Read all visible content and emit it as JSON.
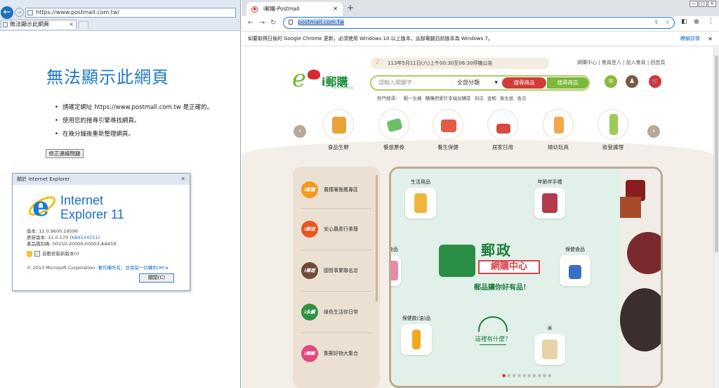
{
  "ie": {
    "address": "https://www.postmall.com.tw/",
    "tab_title": "無法顯示此網頁",
    "tab_close": "×",
    "back_glyph": "←",
    "fwd_glyph": "→",
    "error_title": "無法顯示此網頁",
    "error_items": [
      "請確定網址 https://www.postmall.com.tw 是正確的。",
      "使用您的搜尋引擎尋找網頁。",
      "在幾分鐘後重新整理網頁。"
    ],
    "fix_button": "修正連線問題",
    "about": {
      "title": "關於 Internet Explorer",
      "close_glyph": "✕",
      "product_line1": "Internet",
      "product_line2": "Explorer 11",
      "version": "版本: 11.0.9600.19596",
      "update_prefix": "更新版本: 11.0.170 (",
      "update_kb": "KB4534251",
      "update_suffix": ")",
      "product_id": "產品識別碼: 00150-20000-00003-AA459",
      "auto_update": "自動安裝新版本(I)",
      "check_glyph": "✓",
      "copyright": "© 2013 Microsoft Corporation.",
      "rights": " 著作權所有，並保留一切權利(M) ▸",
      "close_button": "關閉(C)"
    }
  },
  "chrome": {
    "tab_title": "i郵購-Postmall",
    "tab_close": "✕",
    "new_tab": "+",
    "window_min": "—",
    "window_max": "□",
    "window_close": "✕",
    "nav_back": "←",
    "nav_forward": "→",
    "nav_reload": "↻",
    "url": "postmall.com.tw",
    "share_glyph": "⇪",
    "star_glyph": "☆",
    "sidepanel_glyph": "◧",
    "profile_glyph": "●",
    "menu_glyph": "⋮",
    "info_text": "如要取得日後的 Google Chrome 更新，必須使用 Windows 10 以上版本。這部電腦目前版本為 Windows 7。",
    "info_more": "瞭解詳情",
    "info_close": "✕"
  },
  "site": {
    "notice": "113年5月11日(六)上午00:30至06:30停機公告",
    "top_links": "網購中心 | 會員登入 | 加入會員 | 回首頁",
    "logo_e": "e",
    "logo_text": "i郵購",
    "logo_sub": "POSTMALL",
    "search_placeholder": "請輸入關鍵字",
    "category_select": "全部分類",
    "search_products": "搜尋商品",
    "search_stores": "搜尋商店",
    "hot_label": "熱門搜尋：",
    "hot_terms": [
      "蝦一生機",
      "購購把愛珍幸福加購區",
      "刻瓜",
      "金鮑",
      "衛生紙",
      "香瓜"
    ],
    "icons": {
      "list": "≡",
      "user": "♟",
      "cart": "🛒"
    },
    "prev": "‹",
    "next": "›",
    "categories": [
      "食品生鮮",
      "餐旅票券",
      "養生保健",
      "居家日用",
      "婦幼玩具",
      "妝髮護理"
    ],
    "side_items": [
      {
        "badge": "i郵讚",
        "label": "農糧署推薦專區"
      },
      {
        "badge": "i郵送",
        "label": "安心農產行事曆"
      },
      {
        "badge": "i樂遊",
        "label": "國營事業聯名店"
      },
      {
        "badge": "i永續",
        "label": "綠色生活你日常"
      },
      {
        "badge": "i樂郵",
        "label": "集郵好物大集合"
      }
    ],
    "banner": {
      "products": [
        "生活用品",
        "年節伴手禮",
        "食品",
        "保健食品",
        "保健飲(油)品",
        "米"
      ],
      "title": "郵政",
      "subtitle": "網購中心",
      "slogan": "郵品讓你好有品！",
      "bag_text": "這裡有什麼？",
      "dots": "●●●●●●●●●"
    }
  }
}
